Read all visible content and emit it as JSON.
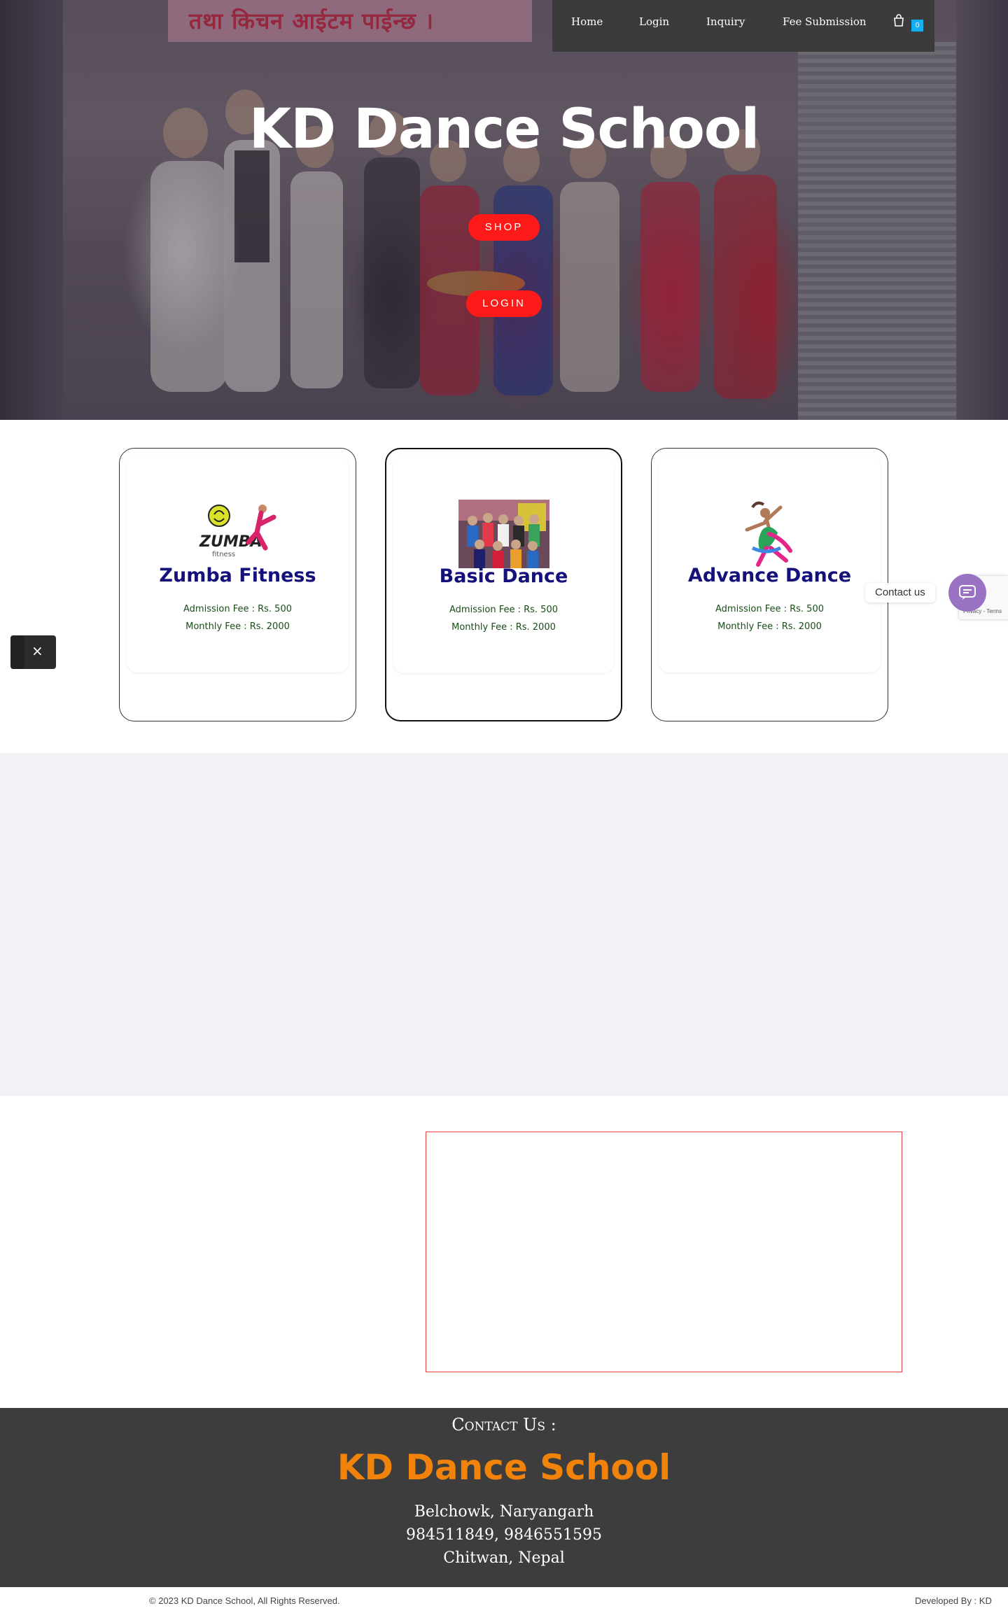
{
  "hero": {
    "sign_text": "तथा किचन आईटम पाईन्छ ।",
    "title": "KD Dance School",
    "shop_button": "SHOP",
    "login_button": "LOGIN"
  },
  "nav": {
    "items": [
      {
        "label": "Home"
      },
      {
        "label": "Login"
      },
      {
        "label": "Inquiry"
      },
      {
        "label": "Fee Submission"
      }
    ],
    "cart_count": "0"
  },
  "cards": [
    {
      "title": "Zumba Fitness",
      "admission": "Admission Fee : Rs. 500",
      "monthly": "Monthly Fee : Rs. 2000",
      "logo_text": "ZUMBA",
      "logo_sub": "fitness"
    },
    {
      "title": "Basic Dance",
      "admission": "Admission Fee : Rs. 500",
      "monthly": "Monthly Fee : Rs. 2000"
    },
    {
      "title": "Advance Dance",
      "admission": "Admission Fee : Rs. 500",
      "monthly": "Monthly Fee : Rs. 2000"
    }
  ],
  "footer": {
    "heading": "Contact Us :",
    "brand": "KD Dance School",
    "address": "Belchowk, Naryangarh",
    "phones": "984511849, 9846551595",
    "location": "Chitwan, Nepal"
  },
  "bottom": {
    "copyright": "© 2023 KD Dance School, All Rights Reserved.",
    "developer": "Developed By : KD"
  },
  "floaters": {
    "close_symbol": "×",
    "contact_label": "Contact us",
    "recaptcha_text": "Privacy - Terms"
  },
  "colors": {
    "button_red": "#ff1a1a",
    "card_title": "#14127a",
    "fee_text": "#1b4d1b",
    "footer_brand": "#f1830a",
    "cart_badge": "#13aff0",
    "contact_fab": "#9a72c4"
  }
}
